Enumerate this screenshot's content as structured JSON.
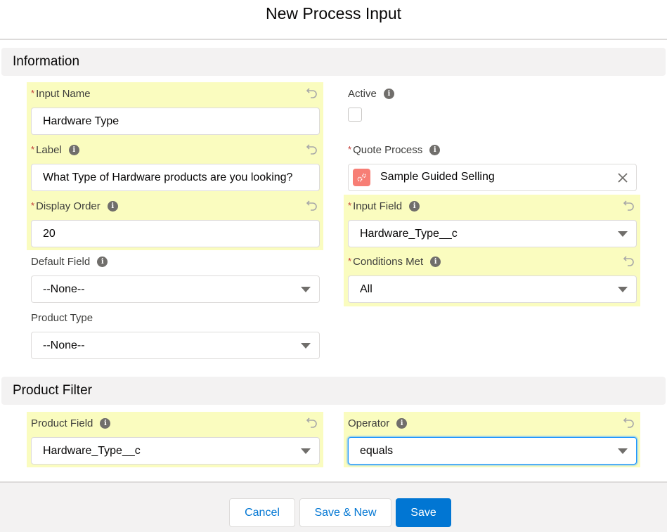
{
  "modal": {
    "title": "New Process Input"
  },
  "sections": {
    "information": "Information",
    "product_filter": "Product Filter"
  },
  "fields": {
    "input_name": {
      "label": "Input Name",
      "required": true,
      "value": "Hardware Type"
    },
    "label": {
      "label": "Label",
      "required": true,
      "value": "What Type of Hardware products are you looking?"
    },
    "display_order": {
      "label": "Display Order",
      "required": true,
      "value": "20"
    },
    "default_field": {
      "label": "Default Field",
      "required": false,
      "value": "--None--"
    },
    "product_type": {
      "label": "Product Type",
      "required": false,
      "value": "--None--"
    },
    "active": {
      "label": "Active",
      "checked": false
    },
    "quote_process": {
      "label": "Quote Process",
      "required": true,
      "value": "Sample Guided Selling"
    },
    "input_field": {
      "label": "Input Field",
      "required": true,
      "value": "Hardware_Type__c"
    },
    "conditions_met": {
      "label": "Conditions Met",
      "required": true,
      "value": "All"
    },
    "product_field": {
      "label": "Product Field",
      "required": false,
      "value": "Hardware_Type__c"
    },
    "operator": {
      "label": "Operator",
      "required": false,
      "value": "equals"
    }
  },
  "required_marker": "*",
  "info_glyph": "i",
  "footer": {
    "cancel": "Cancel",
    "save_new": "Save & New",
    "save": "Save"
  },
  "colors": {
    "brand": "#0176d3",
    "changed_highlight": "#fafcbf",
    "required": "#c23934",
    "lookup_icon": "#f77e75"
  }
}
